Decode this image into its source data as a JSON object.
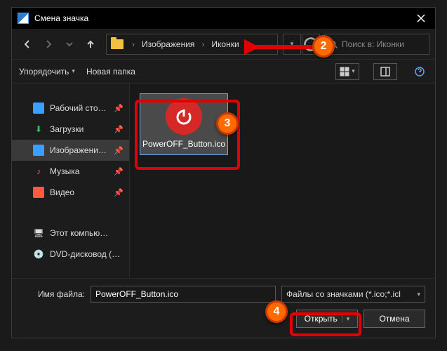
{
  "window": {
    "title": "Смена значка"
  },
  "nav": {
    "crumb1": "Изображения",
    "crumb2": "Иконки",
    "search_placeholder": "Поиск в: Иконки"
  },
  "toolbar": {
    "organize": "Упорядочить",
    "new_folder": "Новая папка"
  },
  "sidebar": {
    "items": [
      {
        "label": "Рабочий сто…",
        "icon": "desktop",
        "color": "#3aa0ff"
      },
      {
        "label": "Загрузки",
        "icon": "download",
        "color": "#35c06a"
      },
      {
        "label": "Изображени…",
        "icon": "pictures",
        "color": "#3aa0ff",
        "selected": true
      },
      {
        "label": "Музыка",
        "icon": "music",
        "color": "#ff5b8a"
      },
      {
        "label": "Видео",
        "icon": "video",
        "color": "#ff5b3a"
      }
    ],
    "lower": [
      {
        "label": "Этот компью…",
        "icon": "pc"
      },
      {
        "label": "DVD-дисковод (…",
        "icon": "dvd"
      }
    ]
  },
  "files": [
    {
      "name": "PowerOFF_Button.ico"
    }
  ],
  "footer": {
    "label": "Имя файла:",
    "value": "PowerOFF_Button.ico",
    "filter": "Файлы со значками (*.ico;*.icl",
    "open": "Открыть",
    "cancel": "Отмена"
  },
  "annotations": {
    "b2": "2",
    "b3": "3",
    "b4": "4"
  }
}
